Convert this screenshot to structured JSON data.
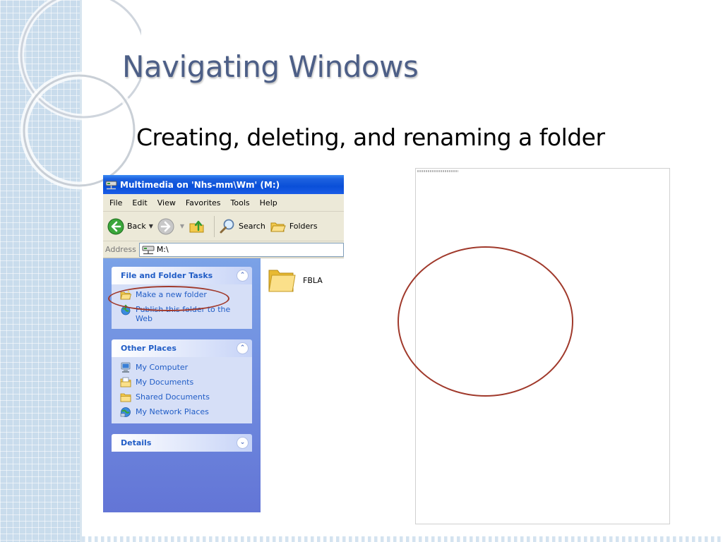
{
  "slide": {
    "title": "Navigating Windows",
    "subtitle": "Creating, deleting, and renaming a folder"
  },
  "window": {
    "title": "Multimedia on 'Nhs-mm\\Wm' (M:)",
    "menu": [
      "File",
      "Edit",
      "View",
      "Favorites",
      "Tools",
      "Help"
    ],
    "toolbar": {
      "back_label": "Back",
      "search_label": "Search",
      "folders_label": "Folders"
    },
    "address": {
      "label": "Address",
      "value": "M:\\"
    }
  },
  "task_pane": {
    "file_folder_tasks": {
      "title": "File and Folder Tasks",
      "items": [
        "Make a new folder",
        "Publish this folder to the Web"
      ]
    },
    "other_places": {
      "title": "Other Places",
      "items": [
        "My Computer",
        "My Documents",
        "Shared Documents",
        "My Network Places"
      ]
    },
    "details": {
      "title": "Details"
    }
  },
  "files": [
    {
      "name": "FBLA",
      "icon": "folder-icon"
    }
  ],
  "colors": {
    "title_blue": "#4d5f87",
    "xp_title_bar": "#0a4fd8",
    "task_pane_top": "#7ba2e7",
    "task_link": "#215dc6",
    "highlight_oval": "#a0392b"
  }
}
